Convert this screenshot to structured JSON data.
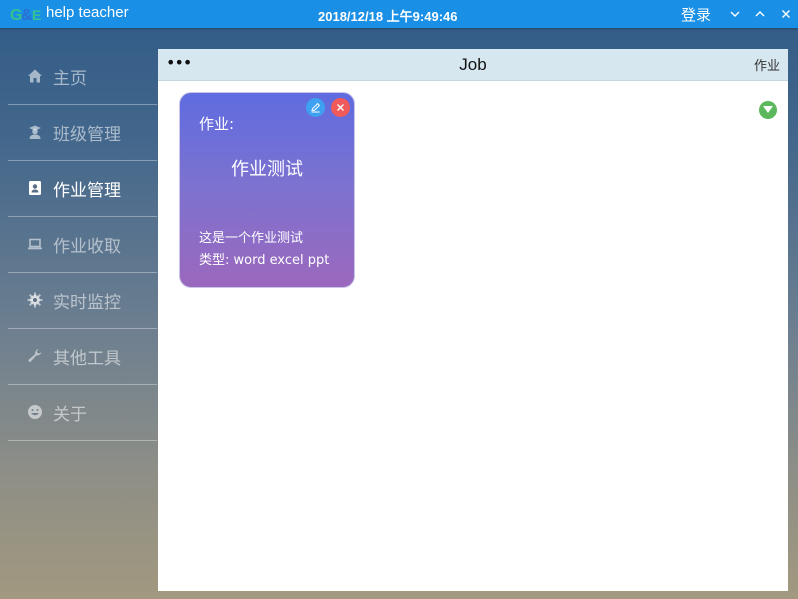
{
  "titlebar": {
    "app_name": "help teacher",
    "datetime": "2018/12/18 上午9:49:46",
    "login_label": "登录",
    "logo_icon": "app-logo-icon",
    "colors": {
      "bar": "#1a8fe6"
    }
  },
  "sidebar": {
    "items": [
      {
        "label": "主页",
        "icon": "home-icon",
        "active": false
      },
      {
        "label": "班级管理",
        "icon": "user-tie-icon",
        "active": false
      },
      {
        "label": "作业管理",
        "icon": "contact-card-icon",
        "active": true
      },
      {
        "label": "作业收取",
        "icon": "laptop-icon",
        "active": false
      },
      {
        "label": "实时监控",
        "icon": "gear-icon",
        "active": false
      },
      {
        "label": "其他工具",
        "icon": "wrench-icon",
        "active": false
      },
      {
        "label": "关于",
        "icon": "smile-icon",
        "active": false
      }
    ]
  },
  "panel": {
    "more": "•••",
    "title": "Job",
    "right_label": "作业"
  },
  "card": {
    "label": "作业:",
    "title": "作业测试",
    "description": "这是一个作业测试",
    "type_text": "类型: word excel ppt",
    "colors": {
      "top": "#5f6ce0",
      "bottom": "#9b68bd",
      "edit": "#3ea0f0",
      "delete": "#f05a5a"
    }
  }
}
